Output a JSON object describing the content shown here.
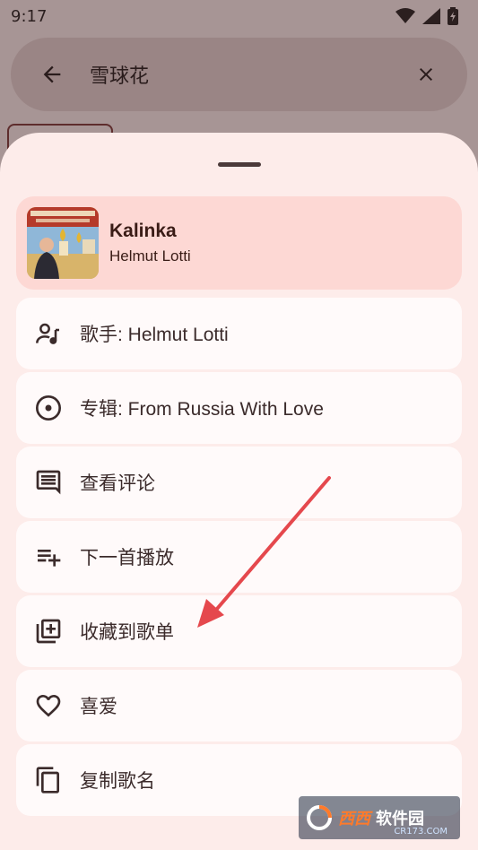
{
  "status_bar": {
    "time": "9:17"
  },
  "search": {
    "query": "雪球花"
  },
  "track": {
    "title": "Kalinka",
    "artist": "Helmut Lotti"
  },
  "menu": [
    {
      "icon": "artist-icon",
      "label": "歌手: Helmut Lotti"
    },
    {
      "icon": "album-icon",
      "label": "专辑: From Russia With Love"
    },
    {
      "icon": "comment-icon",
      "label": "查看评论"
    },
    {
      "icon": "play-next-icon",
      "label": "下一首播放"
    },
    {
      "icon": "add-to-playlist-icon",
      "label": "收藏到歌单"
    },
    {
      "icon": "heart-icon",
      "label": "喜爱"
    },
    {
      "icon": "copy-icon",
      "label": "复制歌名"
    }
  ],
  "watermark": {
    "brand": "西西",
    "text": "软件园",
    "url": "CR173.COM"
  },
  "colors": {
    "sheet": "#fdecea",
    "track_card": "#fdd8d4",
    "arrow": "#e5484d"
  }
}
